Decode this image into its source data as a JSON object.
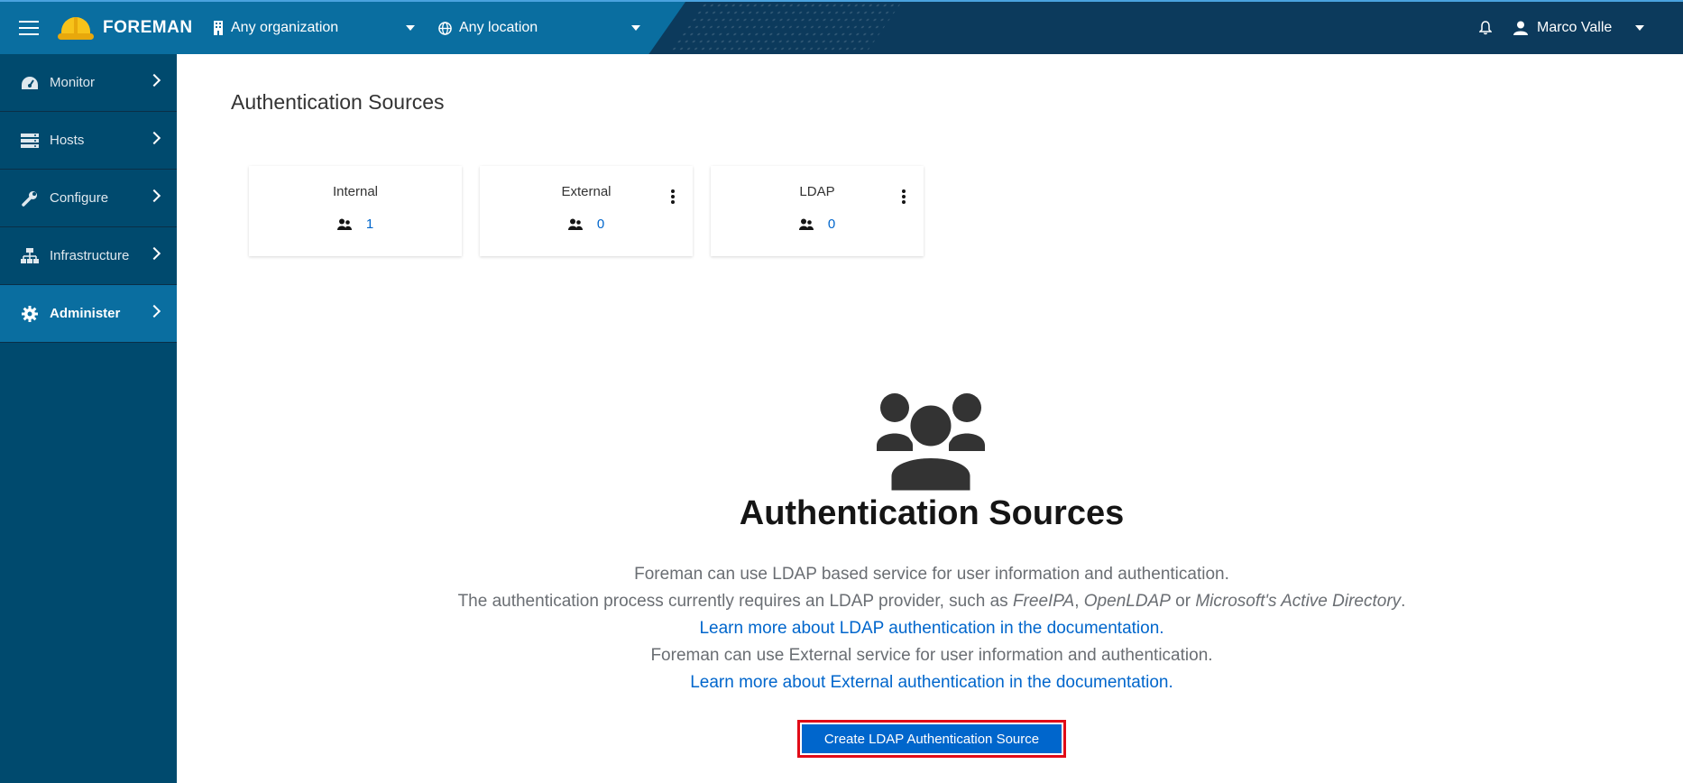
{
  "topbar": {
    "brand": "FOREMAN",
    "organization": "Any organization",
    "location": "Any location",
    "user": "Marco Valle"
  },
  "sidebar": {
    "items": [
      {
        "label": "Monitor",
        "icon": "dashboard-icon"
      },
      {
        "label": "Hosts",
        "icon": "server-icon"
      },
      {
        "label": "Configure",
        "icon": "wrench-icon"
      },
      {
        "label": "Infrastructure",
        "icon": "network-icon"
      },
      {
        "label": "Administer",
        "icon": "gear-icon",
        "active": true
      }
    ]
  },
  "page": {
    "title": "Authentication Sources",
    "cards": [
      {
        "title": "Internal",
        "count": "1"
      },
      {
        "title": "External",
        "count": "0"
      },
      {
        "title": "LDAP",
        "count": "0"
      }
    ]
  },
  "empty_state": {
    "title": "Authentication Sources",
    "line1": "Foreman can use LDAP based service for user information and authentication.",
    "line2_prefix": "The authentication process currently requires an LDAP provider, such as ",
    "line2_freeipa": "FreeIPA",
    "line2_comma": ", ",
    "line2_openldap": "OpenLDAP",
    "line2_or": " or ",
    "line2_msad": "Microsoft's Active Directory",
    "line2_end": ".",
    "link_ldap": "Learn more about LDAP authentication in the documentation.",
    "line4": "Foreman can use External service for user information and authentication.",
    "link_external": "Learn more about External authentication in the documentation.",
    "cta": "Create LDAP Authentication Source"
  },
  "colors": {
    "topbar": "#0a6ea0",
    "sidebar": "#004a6e",
    "accent": "#0066cc",
    "highlight": "#e10b17"
  }
}
